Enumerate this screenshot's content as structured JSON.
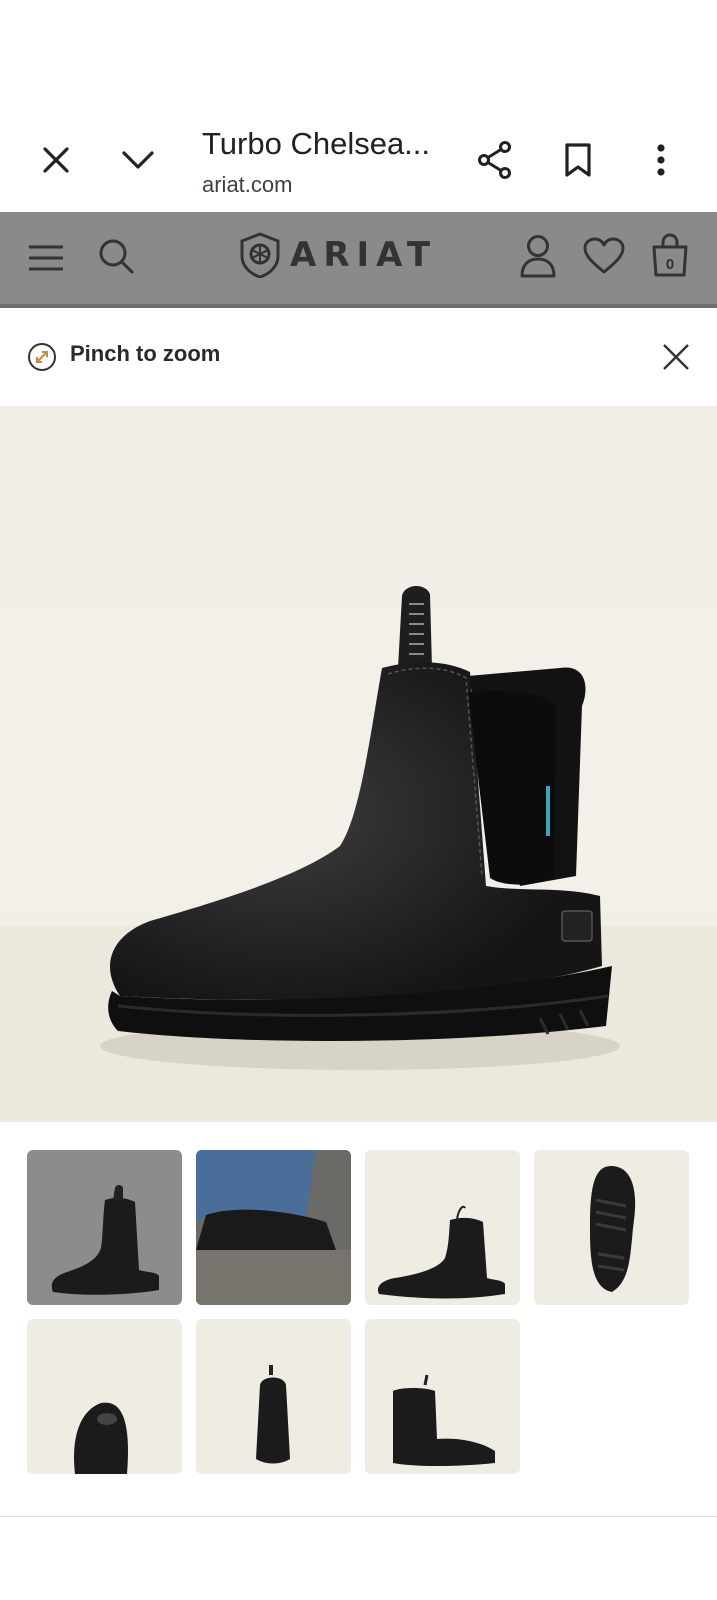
{
  "browser": {
    "title": "Turbo Chelsea...",
    "url": "ariat.com",
    "icons": [
      "close-icon",
      "chevron-down-icon",
      "share-icon",
      "bookmark-icon",
      "more-vert-icon"
    ]
  },
  "site": {
    "brand": "ARIAT",
    "cart_count": "0",
    "icons": [
      "menu-icon",
      "search-icon",
      "account-icon",
      "heart-icon",
      "cart-icon"
    ]
  },
  "zoom": {
    "label": "Pinch to zoom"
  },
  "gallery": {
    "selected_index": 0,
    "thumbnails": [
      "boot-side-dark",
      "boot-worn-outdoors",
      "boot-side-light",
      "boot-sole",
      "boot-toe",
      "boot-back",
      "boot-pair"
    ]
  },
  "colors": {
    "site_header_dim": "#8a8a8a",
    "image_bg": "#f1eee6",
    "boot": "#1b1b1b"
  }
}
